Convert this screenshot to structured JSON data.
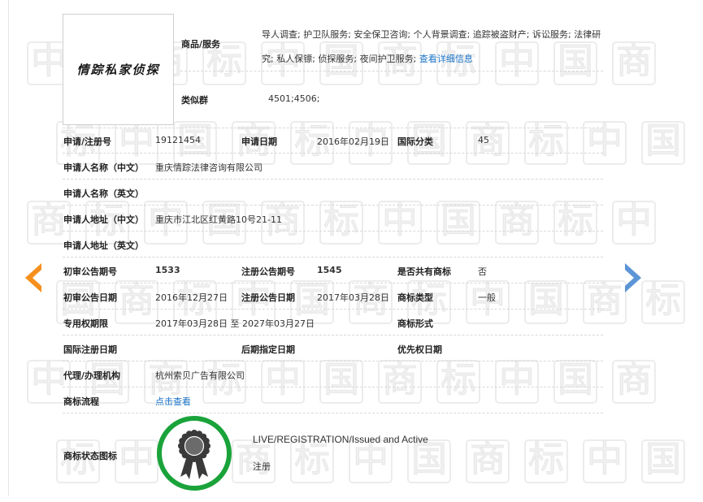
{
  "logo": {
    "text": "情踪私家侦探"
  },
  "goods": {
    "label": "商品/服务",
    "value": "导人调查; 护卫队服务; 安全保卫咨询; 个人背景调查; 追踪被盗财产; 诉讼服务; 法律研究; 私人保镖; 侦探服务; 夜间护卫服务;",
    "link": "查看详细信息"
  },
  "similar_group": {
    "label": "类似群",
    "value": "4501;4506;"
  },
  "rows": {
    "reg_no": {
      "label": "申请/注册号",
      "value": "19121454"
    },
    "apply_date": {
      "label": "申请日期",
      "value": "2016年02月19日"
    },
    "intl_class": {
      "label": "国际分类",
      "value": "45"
    },
    "applicant_cn": {
      "label": "申请人名称（中文）",
      "value": "重庆情踪法律咨询有限公司"
    },
    "applicant_en": {
      "label": "申请人名称（英文）",
      "value": ""
    },
    "address_cn": {
      "label": "申请人地址（中文）",
      "value": "重庆市江北区红黄路10号21-11"
    },
    "address_en": {
      "label": "申请人地址（英文）",
      "value": ""
    },
    "prelim_no": {
      "label": "初审公告期号",
      "value": "1533"
    },
    "reg_pub_no": {
      "label": "注册公告期号",
      "value": "1545"
    },
    "shared": {
      "label": "是否共有商标",
      "value": "否"
    },
    "prelim_date": {
      "label": "初审公告日期",
      "value": "2016年12月27日"
    },
    "reg_pub_date": {
      "label": "注册公告日期",
      "value": "2017年03月28日"
    },
    "mark_type": {
      "label": "商标类型",
      "value": "一般"
    },
    "exclusive": {
      "label": "专用权期限",
      "value": "2017年03月28日 至 2027年03月27日"
    },
    "mark_form": {
      "label": "商标形式",
      "value": ""
    },
    "intl_reg_date": {
      "label": "国际注册日期",
      "value": ""
    },
    "later_date": {
      "label": "后期指定日期",
      "value": ""
    },
    "priority_date": {
      "label": "优先权日期",
      "value": ""
    },
    "agent": {
      "label": "代理/办理机构",
      "value": "杭州索贝广告有限公司"
    },
    "process": {
      "label": "商标流程",
      "link": "点击查看"
    },
    "status": {
      "label": "商标状态图标",
      "status_en": "LIVE/REGISTRATION/Issued and Active",
      "status_cn": "注册"
    }
  },
  "colors": {
    "accent_orange": "#f5901e",
    "accent_blue": "#5b95d6",
    "badge_green": "#1aa33a",
    "badge_dark": "#3a3a3a",
    "link": "#1a73c8"
  },
  "icons": {
    "prev": "arrow-left-icon",
    "next": "arrow-right-icon",
    "status": "registered-badge-icon"
  },
  "watermark": {
    "chars": [
      "中",
      "国",
      "商",
      "标"
    ]
  }
}
